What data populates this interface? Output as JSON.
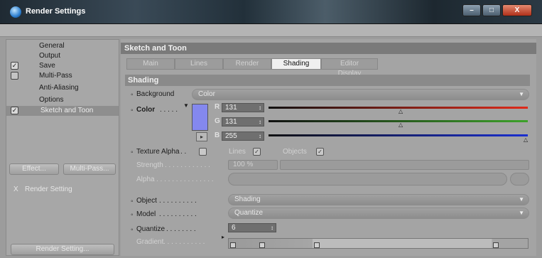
{
  "window": {
    "title": "Render Settings"
  },
  "sidebar": {
    "items": [
      {
        "label": "General",
        "checked": null
      },
      {
        "label": "Output",
        "checked": null
      },
      {
        "label": "Save",
        "checked": true
      },
      {
        "label": "Multi-Pass",
        "checked": false
      },
      {
        "label": "Anti-Aliasing",
        "checked": null
      },
      {
        "label": "Options",
        "checked": null
      },
      {
        "label": "Sketch and Toon",
        "checked": true
      }
    ],
    "effect_button": "Effect...",
    "multipass_button": "Multi-Pass...",
    "render_setting_mark": "X",
    "render_setting_label": "Render Setting",
    "render_setting_button": "Render Setting..."
  },
  "panel": {
    "title": "Sketch and Toon",
    "tabs": [
      "Main",
      "Lines",
      "Render",
      "Shading",
      "Editor Display"
    ],
    "active_tab": "Shading",
    "section": "Shading",
    "background": {
      "label": "Background",
      "value": "Color"
    },
    "color": {
      "label": "Color",
      "swatch_hex": "#8488ee",
      "r_label": "R",
      "r_value": "131",
      "g_label": "G",
      "g_value": "131",
      "b_label": "B",
      "b_value": "255"
    },
    "texture_alpha": {
      "label": "Texture Alpha",
      "lines_label": "Lines",
      "objects_label": "Objects"
    },
    "strength": {
      "label": "Strength",
      "value": "100 %"
    },
    "alpha": {
      "label": "Alpha"
    },
    "object": {
      "label": "Object",
      "value": "Shading"
    },
    "model": {
      "label": "Model",
      "value": "Quantize"
    },
    "quantize": {
      "label": "Quantize",
      "value": "6"
    },
    "gradient": {
      "label": "Gradient"
    }
  },
  "colors": {
    "red_slider": "#e02a1a",
    "green_slider": "#3da22a",
    "blue_slider": "#1a2fd0"
  }
}
